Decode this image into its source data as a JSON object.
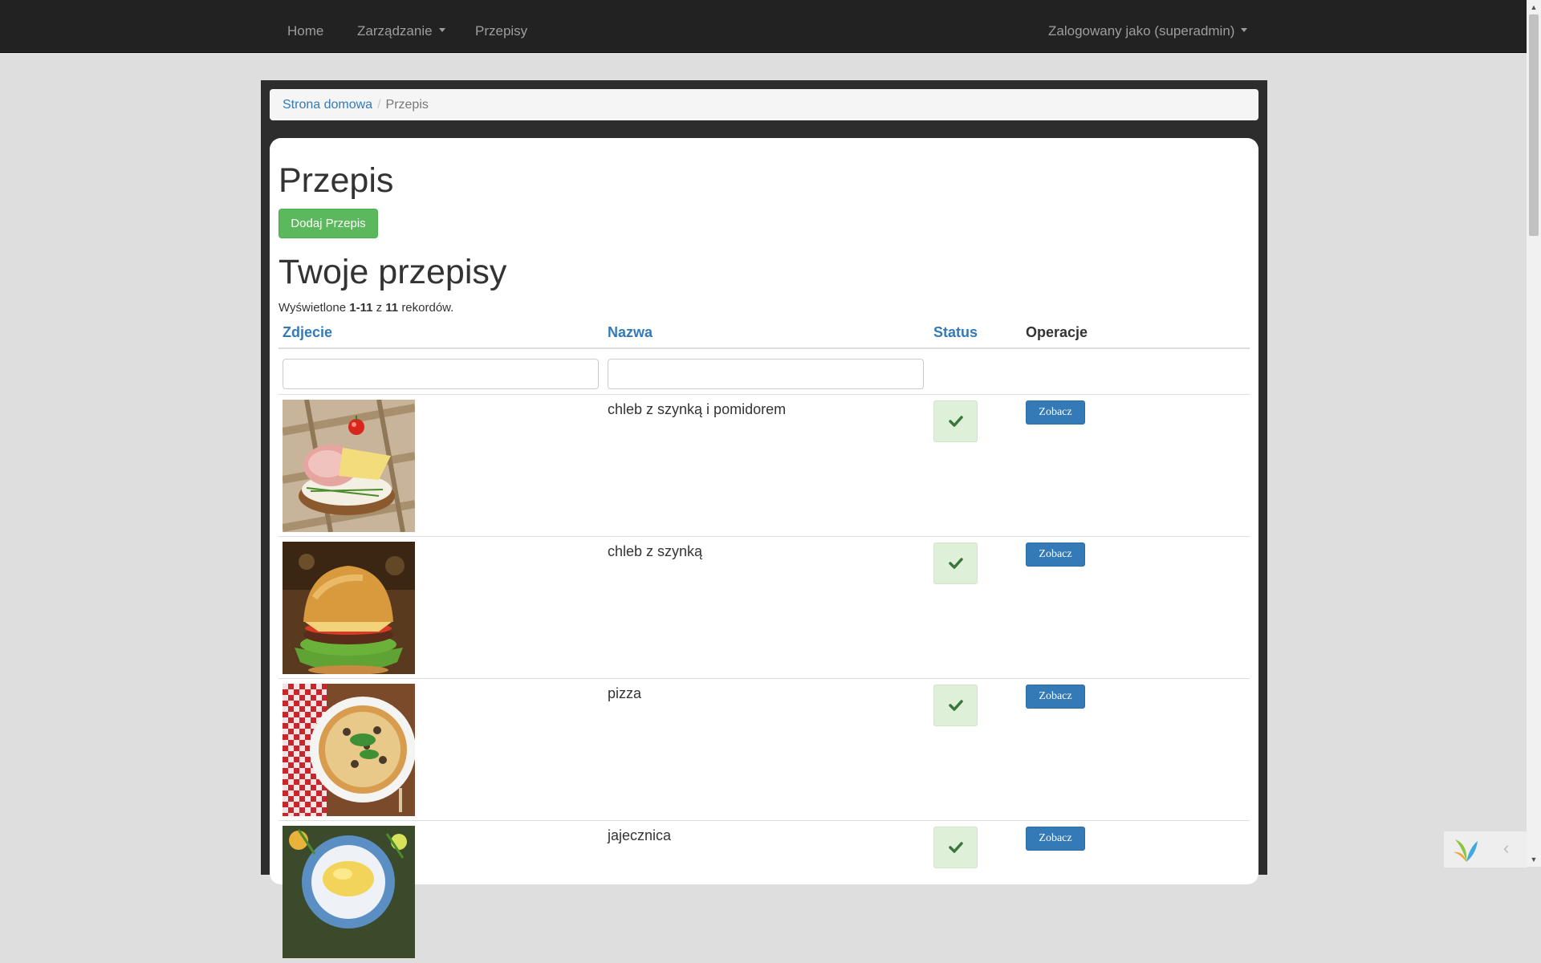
{
  "nav": {
    "home": "Home",
    "manage": "Zarządzanie",
    "recipes": "Przepisy",
    "user": "Zalogowany jako (superadmin)"
  },
  "breadcrumb": {
    "home": "Strona domowa",
    "separator": "/",
    "current": "Przepis"
  },
  "page": {
    "title": "Przepis",
    "add_button": "Dodaj Przepis",
    "section_title": "Twoje przepisy"
  },
  "summary": {
    "prefix": "Wyświetlone",
    "range": "1-11",
    "of": "z",
    "total": "11",
    "suffix": "rekordów."
  },
  "table": {
    "columns": [
      "Zdjecie",
      "Nazwa",
      "Status",
      "Operacje"
    ],
    "rows": [
      {
        "name": "chleb z szynką i pomidorem",
        "image": "ham-sandwich-photo",
        "status": "check-icon",
        "action": "Zobacz"
      },
      {
        "name": "chleb z szynką",
        "image": "burger-photo",
        "status": "check-icon",
        "action": "Zobacz"
      },
      {
        "name": "pizza",
        "image": "pizza-photo",
        "status": "check-icon",
        "action": "Zobacz"
      },
      {
        "name": "jajecznica",
        "image": "scrambled-eggs-photo",
        "status": "check-icon",
        "action": "Zobacz"
      }
    ]
  },
  "colors": {
    "navbar": "#222222",
    "link": "#337ab7",
    "success": "#5cb85c",
    "status_bg": "#dff0d8",
    "check": "#3c763d"
  }
}
